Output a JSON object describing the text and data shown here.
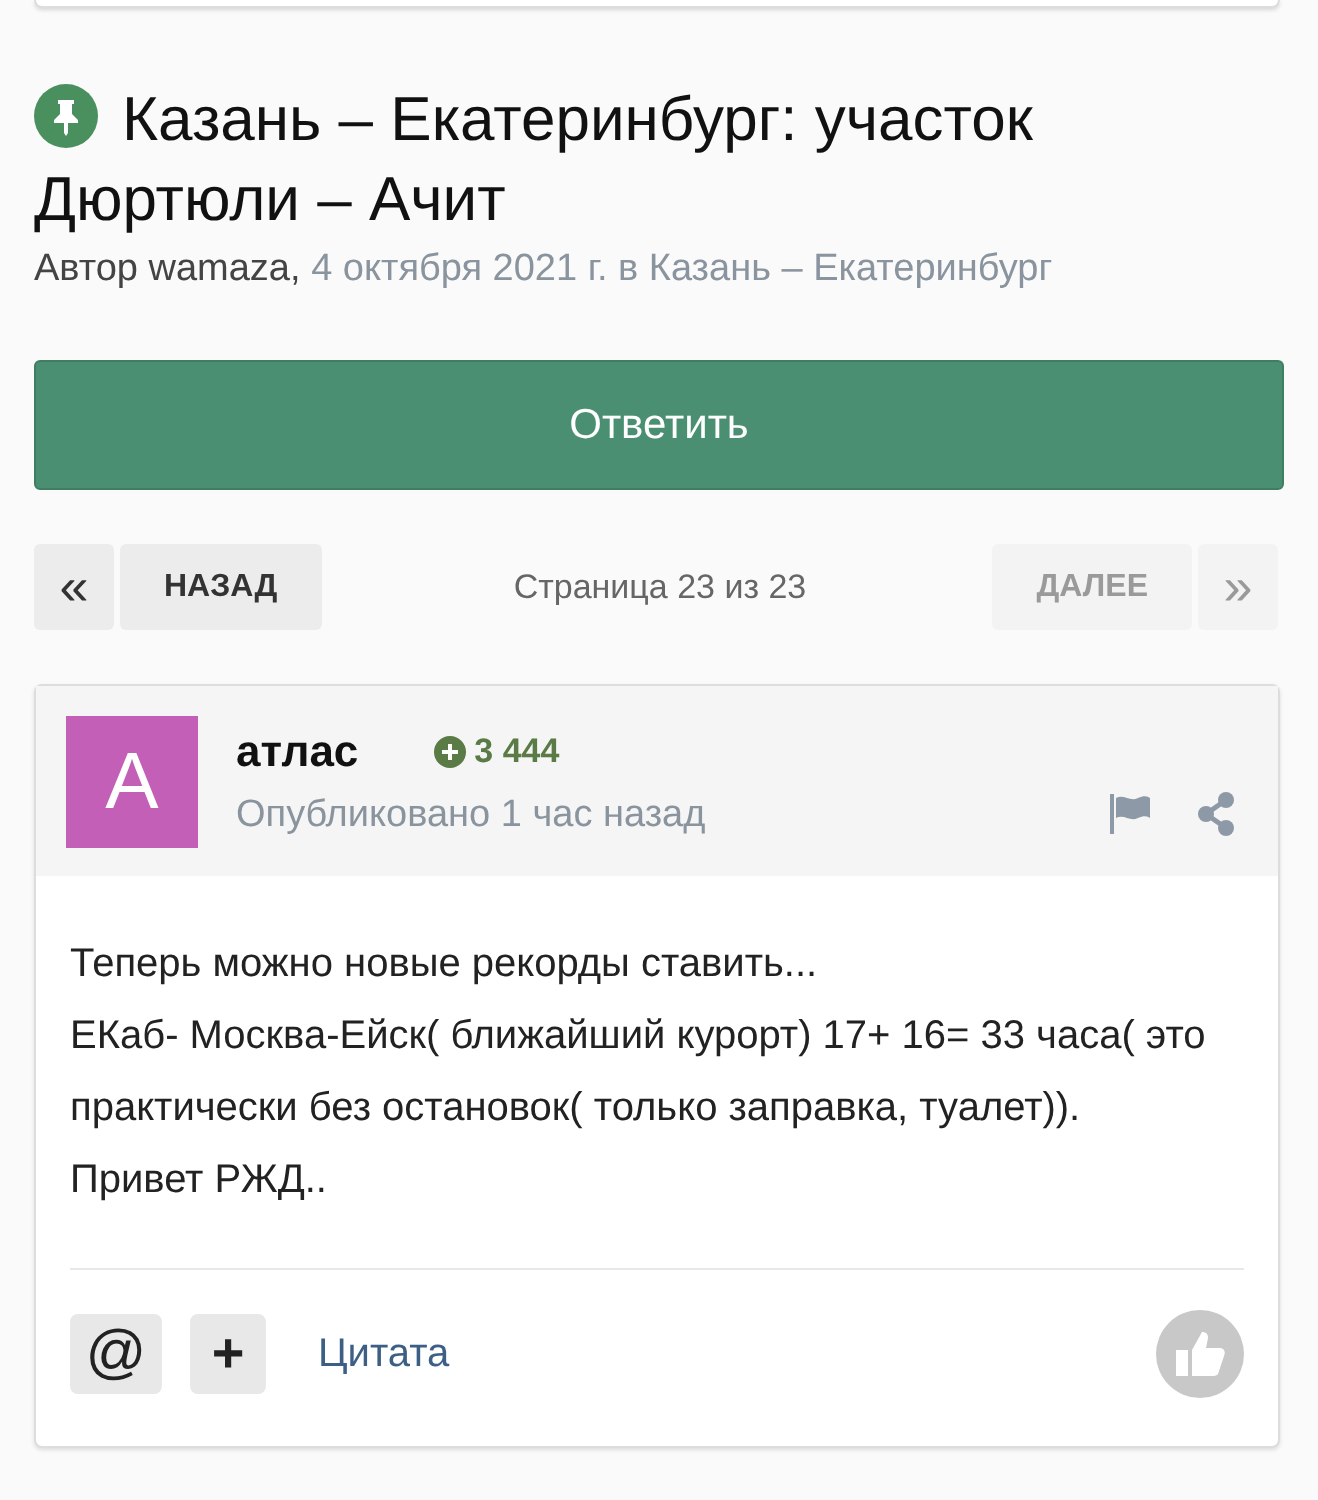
{
  "topic": {
    "pinned": true,
    "title": "Казань – Екатеринбург: участок Дюртюли – Ачит",
    "author_prefix": "Автор wamaza,",
    "meta": "4 октября 2021 г. в Казань – Екатеринбург"
  },
  "reply_button": "Ответить",
  "pagination": {
    "first": {
      "label": "«",
      "disabled": false
    },
    "prev": {
      "label": "НАЗАД",
      "disabled": false
    },
    "page_info": "Страница 23 из 23",
    "next": {
      "label": "ДАЛЕЕ",
      "disabled": true
    },
    "last": {
      "label": "»",
      "disabled": true
    }
  },
  "post": {
    "avatar_letter": "A",
    "color": "#c35fb6",
    "author": "атлас",
    "reputation": "3 444",
    "time": "Опубликовано 1 час назад",
    "paragraphs": [
      "Теперь можно новые рекорды ставить...",
      "ЕКаб- Москва-Ейск( ближайший курорт) 17+ 16= 33 часа( это практически без остановок( только заправка, туалет)).",
      "Привет РЖД.."
    ],
    "actions": {
      "mention": "@",
      "multiquote": "+",
      "quote": "Цитата"
    }
  }
}
